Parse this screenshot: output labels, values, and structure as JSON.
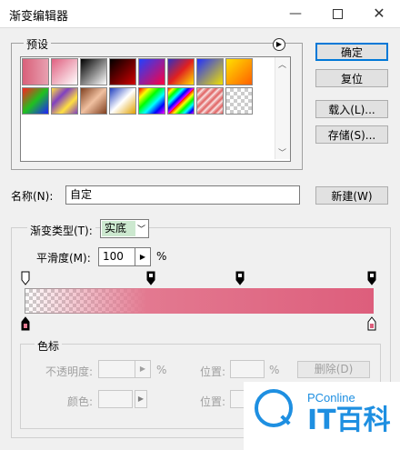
{
  "window": {
    "title": "渐变编辑器"
  },
  "presets": {
    "label": "预设",
    "swatches": [
      "linear-gradient(90deg,#d9607a,#e8a0b0)",
      "linear-gradient(135deg,#e06080,rgba(255,255,255,0))",
      "linear-gradient(135deg,#000,#fff)",
      "linear-gradient(135deg,#000,#d00000)",
      "linear-gradient(135deg,#2040ff,#ff0040)",
      "linear-gradient(135deg,#3030c0,#e02020,#ffe000)",
      "linear-gradient(135deg,#2030ff,#f0e000)",
      "linear-gradient(135deg,#ffe000,#ff6000)",
      "linear-gradient(135deg,#ff2020,#20c020,#2020ff)",
      "linear-gradient(135deg,#ffe040,#8040c0,#ffe040,#8040c0)",
      "linear-gradient(135deg,#804020,#f0c0a0,#804020)",
      "linear-gradient(135deg,#2040c0,#fff,#e0a000)",
      "linear-gradient(135deg,#ff0000,#ffff00,#00ff00,#00ffff,#0000ff,#ff00ff)",
      "repeating-linear-gradient(135deg,#ff0000 0,#ffff00 4px,#00ff00 8px,#00ffff 12px,#0000ff 16px,#ff00ff 20px)",
      "repeating-linear-gradient(135deg,#f0c0c0 0,#e06060 3px,#fff 6px)",
      "checker"
    ]
  },
  "buttons": {
    "ok": "确定",
    "reset": "复位",
    "load": "载入(L)...",
    "save": "存储(S)...",
    "new": "新建(W)",
    "delete": "删除(D)"
  },
  "name": {
    "label": "名称(N):",
    "value": "自定"
  },
  "gradient": {
    "type_label": "渐变类型(T):",
    "type_value": "实底",
    "smooth_label": "平滑度(M):",
    "smooth_value": "100",
    "smooth_unit": "%",
    "start_color": "#e37990",
    "end_color": "#dd5e7c"
  },
  "color_stop": {
    "label": "色标",
    "opacity_label": "不透明度:",
    "opacity_unit": "%",
    "location_label": "位置:",
    "location_unit": "%",
    "color_label": "颜色:",
    "location2_label": "位置:"
  },
  "watermark": {
    "brand": "PConline",
    "name": "IT百科"
  }
}
